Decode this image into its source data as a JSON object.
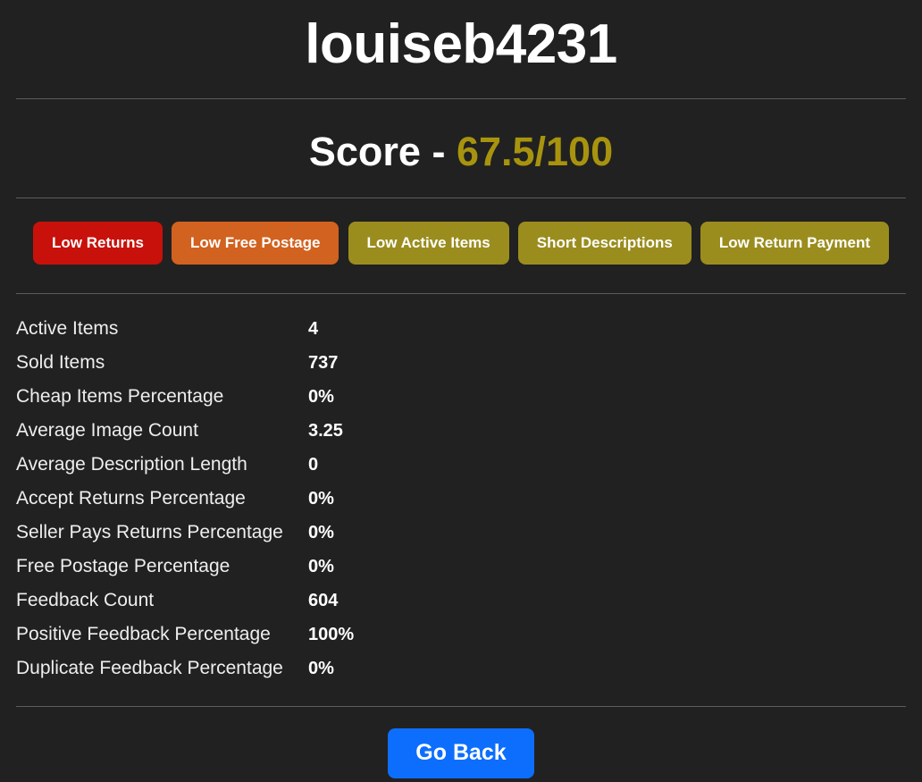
{
  "header": {
    "seller_name": "louiseb4231",
    "score_label": "Score - ",
    "score_value": "67.5/100",
    "score_color": "#a8930f"
  },
  "badges": [
    {
      "label": "Low Returns",
      "color": "#c8110b"
    },
    {
      "label": "Low Free Postage",
      "color": "#d2621f"
    },
    {
      "label": "Low Active Items",
      "color": "#9a8d1e"
    },
    {
      "label": "Short Descriptions",
      "color": "#9a8d1e"
    },
    {
      "label": "Low Return Payment",
      "color": "#9a8d1e"
    }
  ],
  "stats": [
    {
      "label": "Active Items",
      "value": "4"
    },
    {
      "label": "Sold Items",
      "value": "737"
    },
    {
      "label": "Cheap Items Percentage",
      "value": "0%"
    },
    {
      "label": "Average Image Count",
      "value": "3.25"
    },
    {
      "label": "Average Description Length",
      "value": "0"
    },
    {
      "label": "Accept Returns Percentage",
      "value": "0%"
    },
    {
      "label": "Seller Pays Returns Percentage",
      "value": "0%"
    },
    {
      "label": "Free Postage Percentage",
      "value": "0%"
    },
    {
      "label": "Feedback Count",
      "value": "604"
    },
    {
      "label": "Positive Feedback Percentage",
      "value": "100%"
    },
    {
      "label": "Duplicate Feedback Percentage",
      "value": "0%"
    }
  ],
  "footer": {
    "go_back_label": "Go Back",
    "go_back_color": "#0d6efd"
  },
  "theme": {
    "background": "#212121",
    "divider": "#5c5c5c",
    "text": "#ffffff"
  }
}
